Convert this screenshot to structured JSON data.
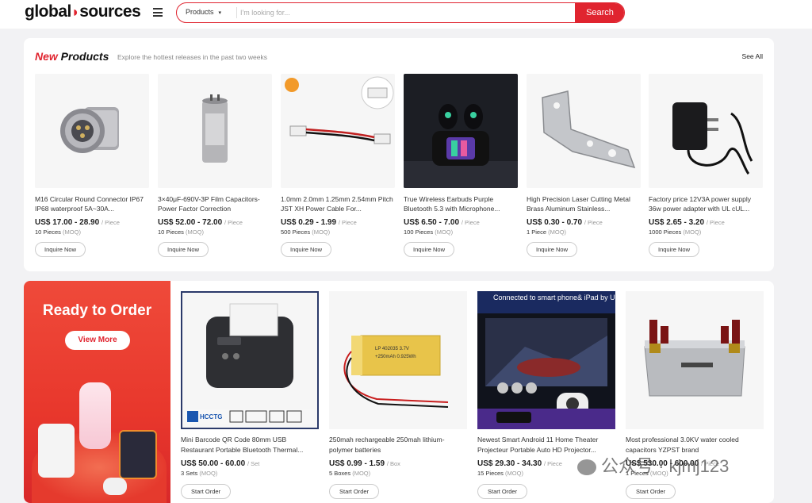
{
  "header": {
    "logo_left": "global",
    "logo_right": "sources",
    "category": "Products",
    "search_placeholder": "I'm looking for...",
    "search_button": "Search"
  },
  "new_products": {
    "title_new": "New",
    "title_rest": " Products",
    "subtitle": "Explore the hottest releases in the past two weeks",
    "see_all": "See All",
    "items": [
      {
        "name": "M16 Circular Round Connector IP67 IP68 waterproof 5A~30A...",
        "price": "US$ 17.00 - 28.90",
        "unit": "/ Piece",
        "moq": "10 Pieces",
        "moq_label": "(MOQ)",
        "cta": "Inquire Now"
      },
      {
        "name": "3×40μF-690V-3P Film Capacitors-Power Factor Correction",
        "price": "US$ 52.00 - 72.00",
        "unit": "/ Piece",
        "moq": "10 Pieces",
        "moq_label": "(MOQ)",
        "cta": "Inquire Now"
      },
      {
        "name": "1.0mm 2.0mm 1.25mm 2.54mm Pitch JST XH Power Cable For...",
        "price": "US$ 0.29 - 1.99",
        "unit": "/ Piece",
        "moq": "500 Pieces",
        "moq_label": "(MOQ)",
        "cta": "Inquire Now"
      },
      {
        "name": "True Wireless Earbuds Purple Bluetooth 5.3 with Microphone...",
        "price": "US$ 6.50 - 7.00",
        "unit": "/ Piece",
        "moq": "100 Pieces",
        "moq_label": "(MOQ)",
        "cta": "Inquire Now"
      },
      {
        "name": "High Precision Laser Cutting Metal Brass Aluminum Stainless...",
        "price": "US$ 0.30 - 0.70",
        "unit": "/ Piece",
        "moq": "1 Piece",
        "moq_label": "(MOQ)",
        "cta": "Inquire Now"
      },
      {
        "name": "Factory price 12V3A power supply 36w power adapter with UL cUL...",
        "price": "US$ 2.65 - 3.20",
        "unit": "/ Piece",
        "moq": "1000 Pieces",
        "moq_label": "(MOQ)",
        "cta": "Inquire Now"
      }
    ]
  },
  "ready_to_order": {
    "banner_title": "Ready to Order",
    "banner_button": "View More",
    "items": [
      {
        "name": "Mini Barcode QR Code 80mm USB Restaurant Portable Bluetooth Thermal...",
        "price": "US$ 50.00 - 60.00",
        "unit": "/ Set",
        "moq": "3 Sets",
        "moq_label": "(MOQ)",
        "cta": "Start Order"
      },
      {
        "name": "250mah rechargeable 250mah lithium-polymer batteries",
        "price": "US$ 0.99 - 1.59",
        "unit": "/ Box",
        "moq": "5 Boxes",
        "moq_label": "(MOQ)",
        "cta": "Start Order"
      },
      {
        "name": "Newest Smart Android 11 Home Theater Projecteur Portable Auto HD Projector...",
        "price": "US$ 29.30 - 34.30",
        "unit": "/ Piece",
        "moq": "15 Pieces",
        "moq_label": "(MOQ)",
        "cta": "Start Order"
      },
      {
        "name": "Most professional 3.0KV water cooled capacitors YZPST brand",
        "price": "US$ 530.00 - 600.00",
        "unit": "/ Piece",
        "moq": "1 Pieces",
        "moq_label": "(MOQ)",
        "cta": "Start Order"
      }
    ]
  },
  "image_text": {
    "printer_brand": "HCCTG",
    "battery_label": "LP 402035 3.7V",
    "battery_label2": "+250mAh 0.925Wh",
    "projector_banner": "Connected to smart phone& iPad by USB cable directly"
  },
  "watermark": "公众号 · kjmj123"
}
